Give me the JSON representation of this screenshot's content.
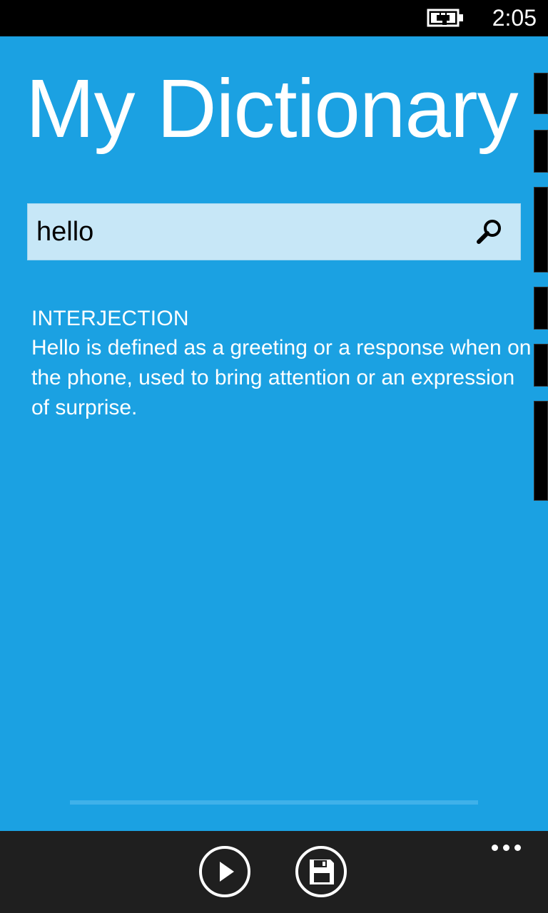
{
  "status_bar": {
    "time": "2:05",
    "battery_icon": "battery-charging-icon"
  },
  "app": {
    "title": "My Dictionary"
  },
  "search": {
    "value": "hello",
    "icon": "search-icon"
  },
  "definition": {
    "part_of_speech": "INTERJECTION",
    "text": "Hello is defined as a greeting or a response when on the phone, used to bring attention or an expression of surprise."
  },
  "playback": {
    "progress": 0
  },
  "app_bar": {
    "buttons": [
      {
        "name": "play",
        "icon": "play-icon"
      },
      {
        "name": "save",
        "icon": "save-icon"
      }
    ],
    "more_icon": "more-options-icon"
  },
  "colors": {
    "accent": "#1ba1e2",
    "search_background": "#c7e7f7",
    "app_bar": "#1f1f1f"
  }
}
